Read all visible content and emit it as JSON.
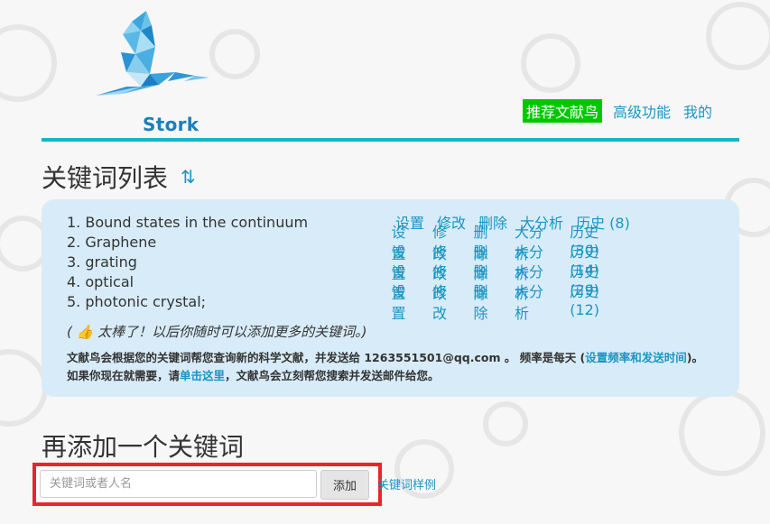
{
  "brand": {
    "name": "Stork"
  },
  "nav": {
    "items": [
      {
        "label": "推荐文献鸟",
        "active": true
      },
      {
        "label": "高级功能",
        "active": false
      },
      {
        "label": "我的",
        "active": false
      }
    ]
  },
  "keywords_section": {
    "title": "关键词列表",
    "sort_icon": "⇅",
    "items": [
      {
        "name": "1. Bound states in the continuum",
        "actions": [
          "设置",
          "修改",
          "删除",
          "大分析",
          "历史 (8)"
        ]
      },
      {
        "name": "2. Graphene",
        "actions": [
          "设置",
          "修改",
          "删除",
          "大分析",
          "历史 (30)"
        ]
      },
      {
        "name": "3. grating",
        "actions": [
          "设置",
          "修改",
          "删除",
          "大分析",
          "历史 (14)"
        ]
      },
      {
        "name": "4. optical",
        "actions": [
          "设置",
          "修改",
          "删除",
          "大分析",
          "历史 (29)"
        ]
      },
      {
        "name": "5. photonic crystal;",
        "actions": [
          "设置",
          "修改",
          "删除",
          "大分析",
          "历史 (12)"
        ]
      }
    ],
    "note": "( 👍 太棒了！以后你随时可以添加更多的关键词。)",
    "desc": {
      "part1": "文献鸟会根据您的关键词帮您查询新的科学文献，并发送给 1263551501@qq.com 。 频率是每天 (",
      "link1": "设置频率和发送时间",
      "part2": ")。 如果你现在就需要，请",
      "link2": "单击这里",
      "part3": "，文献鸟会立刻帮您搜索并发送邮件给您。"
    }
  },
  "add_section": {
    "title": "再添加一个关键词",
    "input_placeholder": "关键词或者人名",
    "input_value": "",
    "add_label": "添加",
    "samples_label": "关键词样例"
  },
  "colors": {
    "accent": "#12b6c9",
    "link": "#1b95c4",
    "active_nav": "#00c800",
    "highlight_border": "#e8262a"
  }
}
